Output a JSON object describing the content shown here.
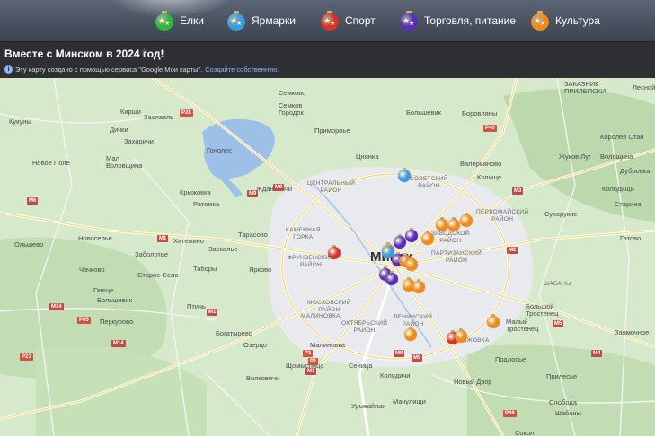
{
  "legend": [
    {
      "label": "Елки",
      "color": "#2db83d",
      "icon": "green-ornament-icon"
    },
    {
      "label": "Ярмарки",
      "color": "#3a9be0",
      "icon": "blue-ornament-icon"
    },
    {
      "label": "Спорт",
      "color": "#d8322a",
      "icon": "red-ornament-icon"
    },
    {
      "label": "Торговля, питание",
      "color": "#5a2bb8",
      "icon": "purple-ornament-icon"
    },
    {
      "label": "Культура",
      "color": "#ef8a1c",
      "icon": "orange-ornament-icon"
    }
  ],
  "header": {
    "title": "Вместе с Минском в 2024 год!",
    "info_text": "Эту карту создано с помощью сервиса \"Google Мои карты\".",
    "info_link": "Создайте собственную."
  },
  "map": {
    "city_label": "Минск",
    "places": [
      {
        "name": "Заказник Прилепский",
        "text": "ЗАКАЗНИК\nПРИЛЕПСКИ"
      },
      {
        "name": "Семково",
        "text": "Семково"
      },
      {
        "name": "Семков Городок",
        "text": "Семков\nГородок"
      },
      {
        "name": "Большевик",
        "text": "Большевик"
      },
      {
        "name": "Боровляны",
        "text": "Боровляны"
      },
      {
        "name": "Лесной",
        "text": "Лесной"
      },
      {
        "name": "Кукуны",
        "text": "Кукуны"
      },
      {
        "name": "Кирши",
        "text": "Кирши"
      },
      {
        "name": "Заславль",
        "text": "Заславль"
      },
      {
        "name": "Дички",
        "text": "Дички"
      },
      {
        "name": "Захаричи",
        "text": "Захаричи"
      },
      {
        "name": "Примороье",
        "text": "Примороье"
      },
      {
        "name": "Гонолес",
        "text": "Гонолес"
      },
      {
        "name": "Новое Поле",
        "text": "Новое Поле"
      },
      {
        "name": "Мал Воловщина",
        "text": "Мал\nВоловщина"
      },
      {
        "name": "Цнянка",
        "text": "Цнянка"
      },
      {
        "name": "Валерьяново",
        "text": "Валерьяново"
      },
      {
        "name": "Королёв Стан",
        "text": "Королёв Стан"
      },
      {
        "name": "Колодищи",
        "text": "Колодищи"
      },
      {
        "name": "Жуков Луг",
        "text": "Жуков Луг"
      },
      {
        "name": "Волощина",
        "text": "Волощина"
      },
      {
        "name": "Крыжовка",
        "text": "Крыжовка"
      },
      {
        "name": "Ждановичи",
        "text": "Ждановичи"
      },
      {
        "name": "Копище",
        "text": "Копище"
      },
      {
        "name": "Старина",
        "text": "Старина"
      },
      {
        "name": "Ратомка",
        "text": "Ратомка"
      },
      {
        "name": "Сухорукие",
        "text": "Сухорукие"
      },
      {
        "name": "Дубровка",
        "text": "Дубровка"
      },
      {
        "name": "Тарасово",
        "text": "Тарасово"
      },
      {
        "name": "Гатово",
        "text": "Гатово"
      },
      {
        "name": "Новоселье",
        "text": "Новоселье"
      },
      {
        "name": "Хатежино",
        "text": "Хатежино"
      },
      {
        "name": "Заболотье",
        "text": "Заболотье"
      },
      {
        "name": "Ольшево",
        "text": "Ольшево"
      },
      {
        "name": "Заскалье",
        "text": "Заскалье"
      },
      {
        "name": "Таборы",
        "text": "Таборы"
      },
      {
        "name": "Ярково",
        "text": "Ярково"
      },
      {
        "name": "Чачково",
        "text": "Чачково"
      },
      {
        "name": "Старое Село",
        "text": "Старое Село"
      },
      {
        "name": "Гаище",
        "text": "Гаище"
      },
      {
        "name": "Большевик 2",
        "text": "Большевик"
      },
      {
        "name": "Перкурово",
        "text": "Перкурово"
      },
      {
        "name": "Птичь",
        "text": "Птичь"
      },
      {
        "name": "Богатырево",
        "text": "Богатырево"
      },
      {
        "name": "Озерцо",
        "text": "Озерцо"
      },
      {
        "name": "Малиновка",
        "text": "Малиновка"
      },
      {
        "name": "Щомыслица",
        "text": "Щомыслица"
      },
      {
        "name": "Сеница",
        "text": "Сеница"
      },
      {
        "name": "Колядичи",
        "text": "Колядичи"
      },
      {
        "name": "Волковичи",
        "text": "Волковичи"
      },
      {
        "name": "Урожайная",
        "text": "Урожайная"
      },
      {
        "name": "Новый Двор",
        "text": "Новый Двор"
      },
      {
        "name": "Большой Тростенец",
        "text": "Большой\nТростенец"
      },
      {
        "name": "Малый Тростенец",
        "text": "Малый\nТростенец"
      },
      {
        "name": "Подлосье",
        "text": "Подлосье"
      },
      {
        "name": "Прилесье",
        "text": "Прилесье"
      },
      {
        "name": "Сеница 2",
        "text": "Слобода"
      },
      {
        "name": "Мачулищи",
        "text": "Мачулищи"
      },
      {
        "name": "Заямочное",
        "text": "Заямочное"
      },
      {
        "name": "Сокол",
        "text": "Сокол"
      },
      {
        "name": "Шабаны",
        "text": "Шабаны"
      }
    ],
    "districts": [
      {
        "text": "ЦЕНТРАЛЬНЫЙ\nРАЙОН"
      },
      {
        "text": "СОВЕТСКИЙ\nРАЙОН"
      },
      {
        "text": "ПЕРВОМАЙСКИЙ\nРАЙОН"
      },
      {
        "text": "ЗАВОДСКОЙ\nРАЙОН"
      },
      {
        "text": "КАМЕННАЯ\nГОРКА"
      },
      {
        "text": "ФРУНЗЕНСКИЙ\nРАЙОН"
      },
      {
        "text": "ПАРТИЗАНСКИЙ\nРАЙОН"
      },
      {
        "text": "МОСКОВСКИЙ\nРАЙОН"
      },
      {
        "text": "МАЛИНОВКА"
      },
      {
        "text": "ОКТЯБРЬСКИЙ\nРАЙОН"
      },
      {
        "text": "ЛЕНИНСКИЙ\nРАЙОН"
      },
      {
        "text": "ЧИЖОВКА"
      },
      {
        "text": "ШАБАНЫ"
      }
    ],
    "roads": [
      "P28",
      "M9",
      "P40",
      "M3",
      "M9",
      "M2",
      "M6",
      "M1",
      "M1",
      "P1",
      "M14",
      "P65",
      "M14",
      "M9",
      "M4",
      "M5",
      "M9",
      "P23",
      "M1",
      "P1",
      "P69"
    ],
    "markers": [
      {
        "category": "Ярмарки"
      },
      {
        "category": "Культура"
      },
      {
        "category": "Культура"
      },
      {
        "category": "Культура"
      },
      {
        "category": "Культура"
      },
      {
        "category": "Торговля, питание"
      },
      {
        "category": "Торговля, питание"
      },
      {
        "category": "Культура"
      },
      {
        "category": "Спорт"
      },
      {
        "category": "Ярмарки"
      },
      {
        "category": "Торговля, питание"
      },
      {
        "category": "Культура"
      },
      {
        "category": "Торговля, питание"
      },
      {
        "category": "Торговля, питание"
      },
      {
        "category": "Культура"
      },
      {
        "category": "Культура"
      },
      {
        "category": "Культура"
      },
      {
        "category": "Спорт"
      },
      {
        "category": "Культура"
      },
      {
        "category": "Культура"
      },
      {
        "category": "Культура"
      }
    ]
  }
}
